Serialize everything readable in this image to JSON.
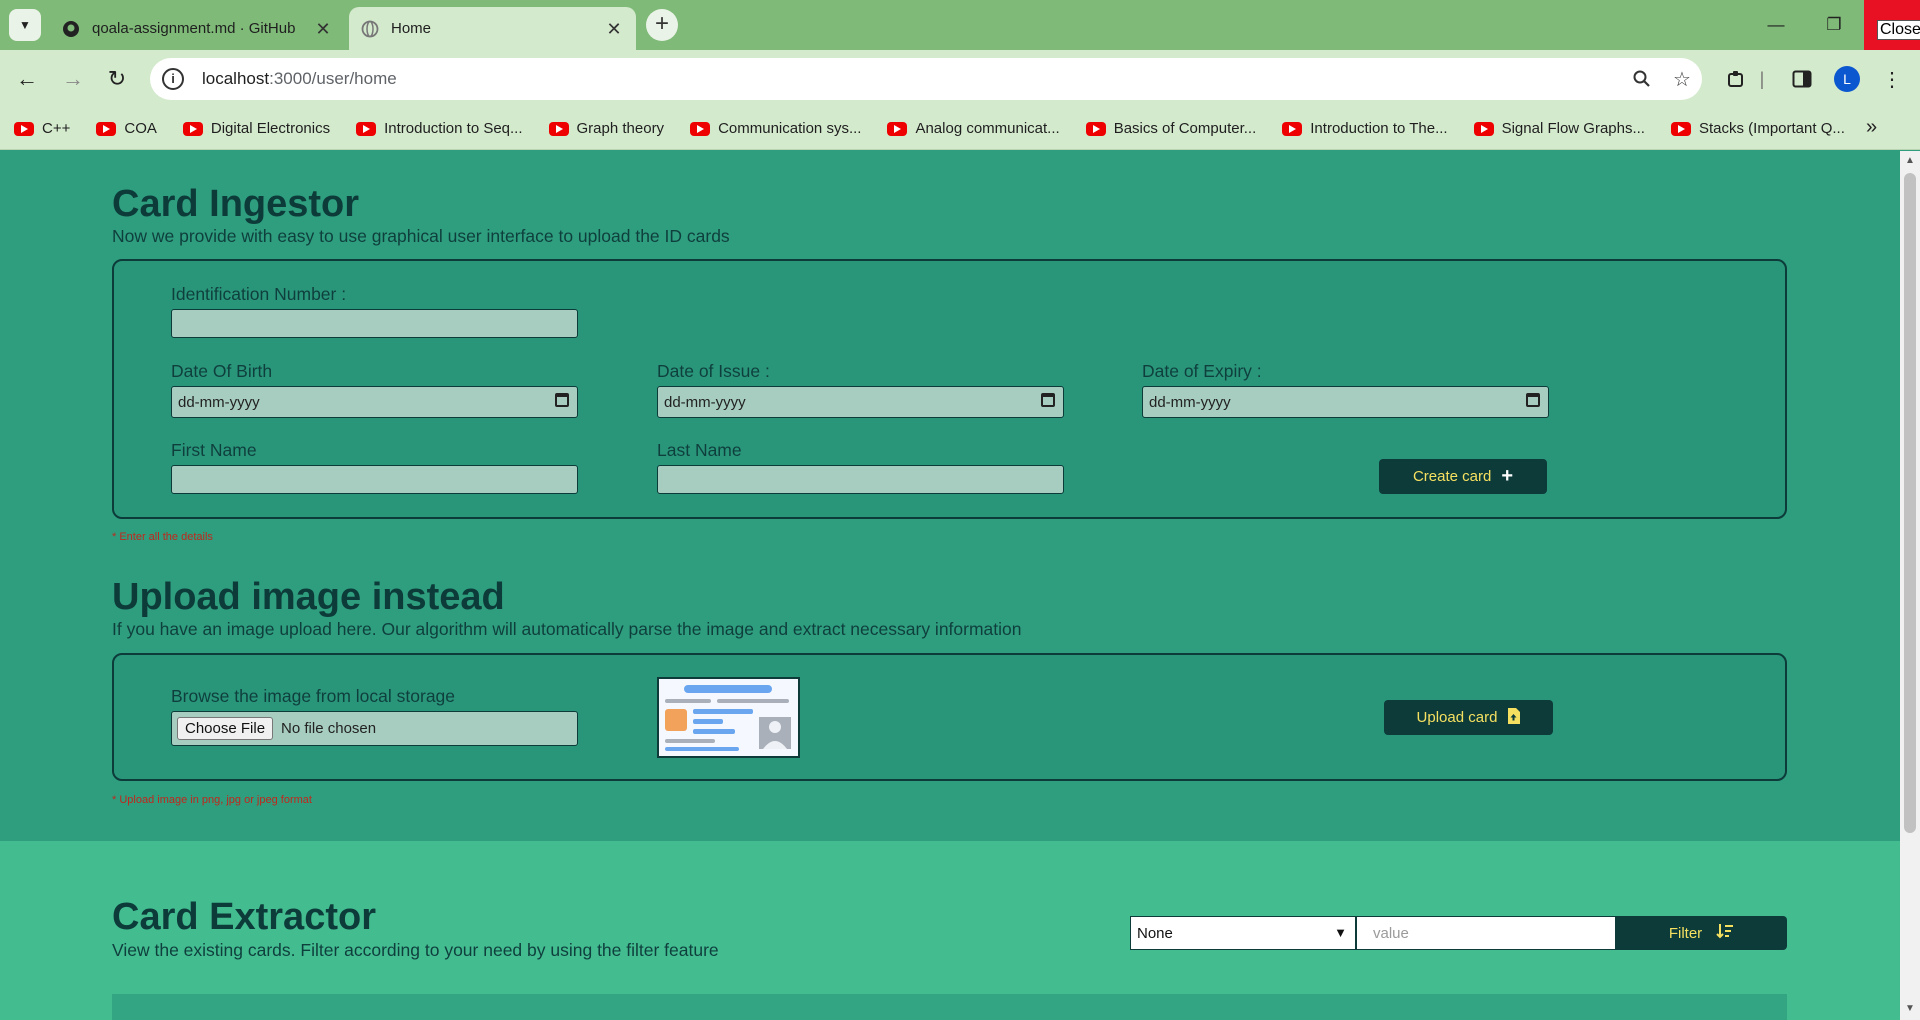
{
  "browser": {
    "tabs": [
      {
        "title": "qoala-assignment.md · GitHub",
        "active": false
      },
      {
        "title": "Home",
        "active": true
      }
    ],
    "close_label": "Close",
    "url_host": "localhost",
    "url_path": ":3000/user/home",
    "avatar_initial": "L",
    "bookmarks": [
      "C++",
      "COA",
      "Digital Electronics",
      "Introduction to Seq...",
      "Graph theory",
      "Communication sys...",
      "Analog communicat...",
      "Basics of Computer...",
      "Introduction to The...",
      "Signal Flow Graphs...",
      "Stacks (Important Q..."
    ],
    "bookmarks_overflow": "»"
  },
  "ingestor": {
    "title": "Card Ingestor",
    "subtitle": "Now we provide with easy to use graphical user interface to upload the ID cards",
    "id_label": "Identification Number :",
    "dob_label": "Date Of Birth",
    "issue_label": "Date of Issue :",
    "expiry_label": "Date of Expiry :",
    "date_placeholder": "dd-mm-yyyy",
    "first_name_label": "First Name",
    "last_name_label": "Last Name",
    "create_button": "Create card",
    "create_icon": "+",
    "note": "* Enter all the details"
  },
  "upload": {
    "title": "Upload image instead",
    "subtitle": "If you have an image upload here. Our algorithm will automatically parse the image and extract necessary information",
    "browse_label": "Browse the image from local storage",
    "choose_file": "Choose File",
    "no_file": "No file chosen",
    "upload_button": "Upload card",
    "note": "* Upload image in png, jpg or jpeg format"
  },
  "extractor": {
    "title": "Card Extractor",
    "subtitle": "View the existing cards. Filter according to your need by using the filter feature",
    "filter_select": "None",
    "filter_placeholder": "value",
    "filter_button": "Filter"
  },
  "colors": {
    "accent_dark": "#0d3b3a",
    "button_text": "#f5e060",
    "section_bg": "#2e9e7e",
    "note_red": "#c0281e"
  }
}
